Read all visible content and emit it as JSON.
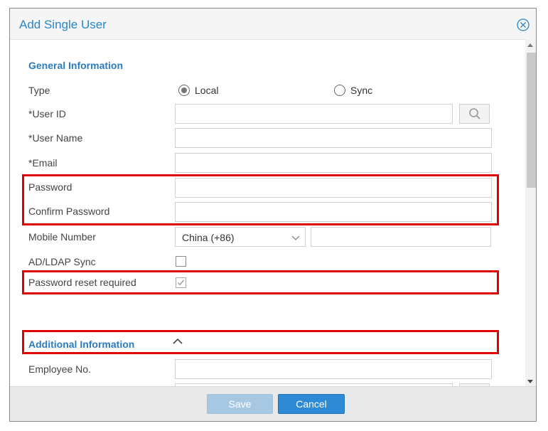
{
  "dialog": {
    "title": "Add Single User"
  },
  "general": {
    "section_title": "General Information",
    "type_label": "Type",
    "type_options": [
      {
        "label": "Local",
        "selected": true
      },
      {
        "label": "Sync",
        "selected": false
      }
    ],
    "user_id_label": "*User ID",
    "user_name_label": "*User Name",
    "email_label": "*Email",
    "password_label": "Password",
    "confirm_password_label": "Confirm Password",
    "mobile_label": "Mobile Number",
    "country_code": "China (+86)",
    "ad_ldap_label": "AD/LDAP Sync",
    "ad_ldap_checked": false,
    "pwd_reset_label": "Password reset required",
    "pwd_reset_checked": true
  },
  "additional": {
    "section_title": "Additional Information",
    "employee_no_label": "Employee No."
  },
  "footer": {
    "save_label": "Save",
    "cancel_label": "Cancel"
  },
  "colors": {
    "accent": "#2a86c6",
    "highlight": "#e00000",
    "primary_button": "#2f8ad6",
    "disabled_button": "#a7c8e3"
  },
  "icons": {
    "close": "close-circle-icon",
    "search": "search-icon",
    "dropdown": "chevron-down-icon",
    "collapse": "chevron-up-icon"
  }
}
